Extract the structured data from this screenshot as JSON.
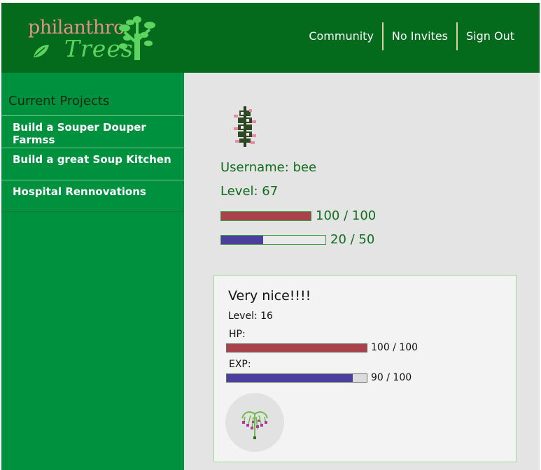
{
  "app": {
    "logo_word_1": "philanthro",
    "logo_word_2": "Trees"
  },
  "header": {
    "nav": [
      {
        "label": "Community"
      },
      {
        "label": "No Invites"
      },
      {
        "label": "Sign Out"
      }
    ]
  },
  "sidebar": {
    "title": "Current Projects",
    "items": [
      {
        "label": "Build a Souper Douper Farmss"
      },
      {
        "label": "Build a great Soup Kitchen"
      },
      {
        "label": "Hospital Rennovations"
      }
    ]
  },
  "profile": {
    "username_text": "Username: bee",
    "level_text": "Level: 67",
    "hp_text": "100 / 100",
    "hp_fraction": 1.0,
    "exp_text": "20 / 50",
    "exp_fraction": 0.4,
    "avatar_icon": "pixel-tree-icon"
  },
  "card": {
    "title": "Very nice!!!!",
    "level_text": "Level: 16",
    "hp_label": "HP:",
    "hp_text": "100 / 100",
    "hp_fraction": 1.0,
    "exp_label": "EXP:",
    "exp_text": "90 / 100",
    "exp_fraction": 0.9,
    "avatar_icon": "pixel-tree-icon"
  },
  "colors": {
    "header_bg": "#046b1d",
    "sidebar_bg": "#00913f",
    "hp_bar": "#a8434a",
    "exp_bar": "#4b3f9e",
    "text_green": "#0f6d1c"
  }
}
